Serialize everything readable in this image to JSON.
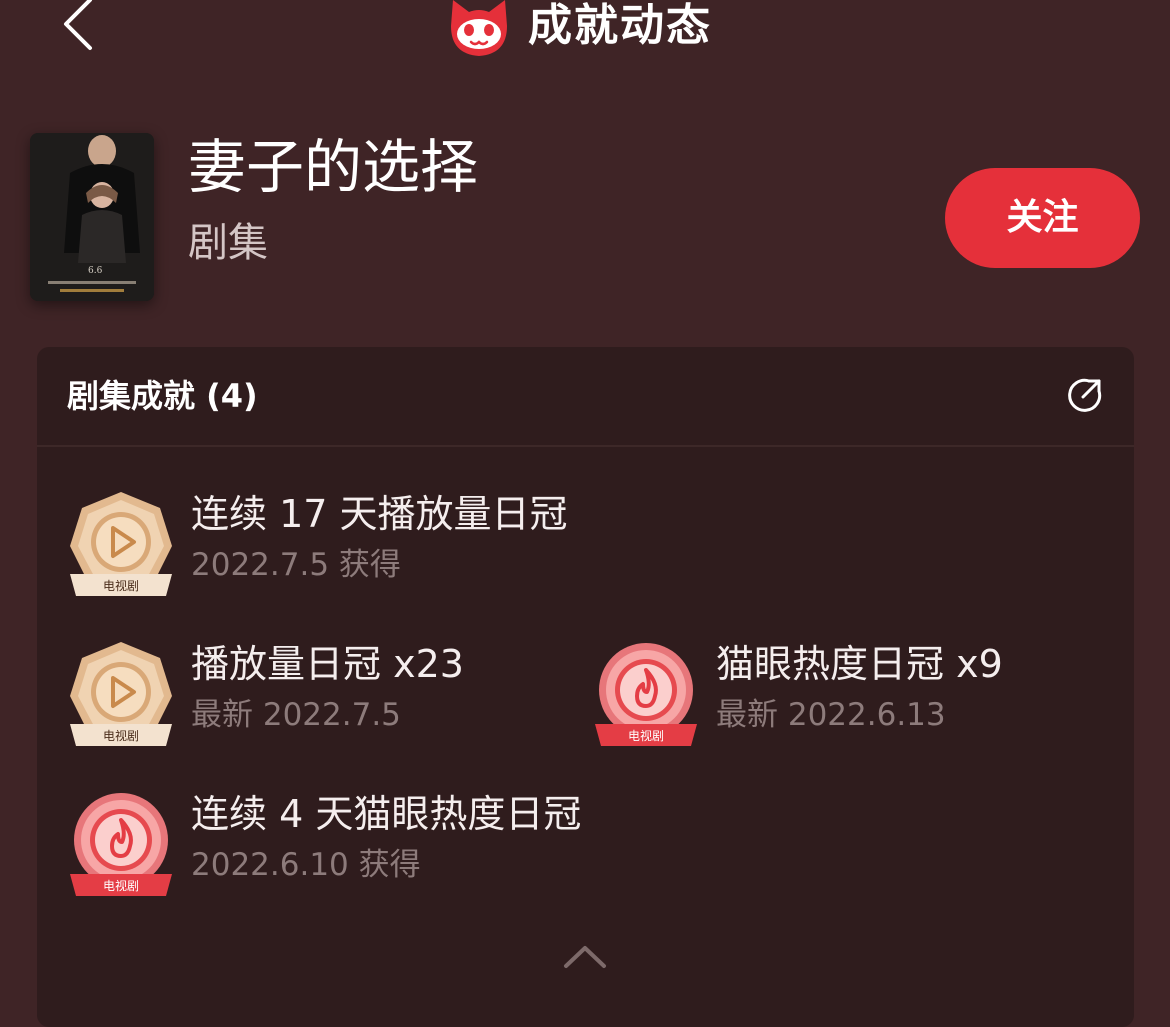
{
  "header": {
    "title": "成就动态",
    "back_icon": "chevron-left-icon",
    "logo_icon": "cat-logo-icon"
  },
  "show": {
    "title": "妻子的选择",
    "type": "剧集",
    "follow_label": "关注",
    "poster_date": "6.6"
  },
  "achievements": {
    "header_title": "剧集成就 (4)",
    "share_icon": "share-icon",
    "badge_label": "电视剧",
    "items": [
      {
        "title": "连续 17 天播放量日冠",
        "date": "2022.7.5 获得",
        "badge": "play-badge-icon"
      },
      {
        "title": "播放量日冠 x23",
        "date": "最新 2022.7.5",
        "badge": "play-badge-icon"
      },
      {
        "title": "猫眼热度日冠 x9",
        "date": "最新 2022.6.13",
        "badge": "flame-badge-icon"
      },
      {
        "title": "连续 4 天猫眼热度日冠",
        "date": "2022.6.10 获得",
        "badge": "flame-badge-icon"
      }
    ],
    "collapse_icon": "chevron-up-icon"
  },
  "colors": {
    "background": "#3f2426",
    "card": "#2f1c1d",
    "accent": "#e5303a"
  }
}
